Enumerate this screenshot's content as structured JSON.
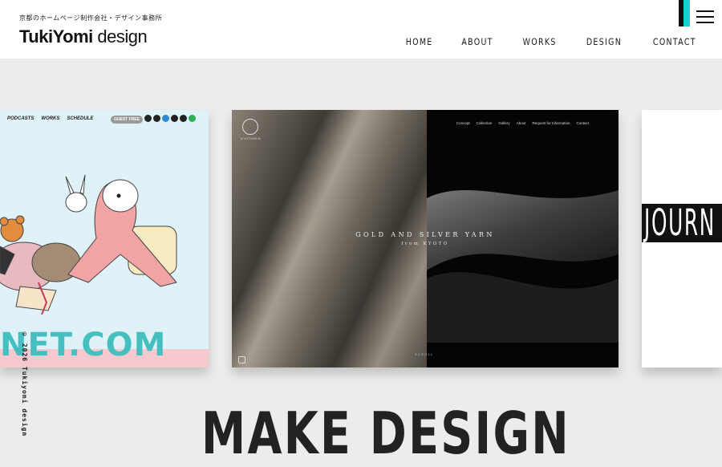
{
  "header": {
    "tagline": "京都のホームページ制作会社・デザイン事務所",
    "logo_bold": "TukiYomi",
    "logo_light": " design",
    "nav": [
      "HOME",
      "ABOUT",
      "WORKS",
      "DESIGN",
      "CONTACT"
    ],
    "accent_color": "#17d3d3"
  },
  "cards": [
    {
      "nav": [
        "PODCASTS",
        "WORKS",
        "SCHEDULE"
      ],
      "pill": "GUEST FREE",
      "icons": [
        "instagram-icon",
        "x-icon",
        "bluesky-icon",
        "threads-icon",
        "youtube-icon",
        "spotify-icon"
      ],
      "big_text": "NET.COM"
    },
    {
      "brand": "KYOTORIIX",
      "nav": [
        "Concept",
        "Collection",
        "Gallery",
        "About",
        "Request for Information",
        "Contact"
      ],
      "lang": [
        "JP",
        "EN"
      ],
      "headline": "GOLD AND SILVER YARN",
      "sub": "from KYOTO",
      "scroll": "SCROLL"
    },
    {
      "big_text": "JOURN"
    }
  ],
  "copyright": "© 2026 Tukiyomi design",
  "hero_text": "MAKE DESIGN"
}
